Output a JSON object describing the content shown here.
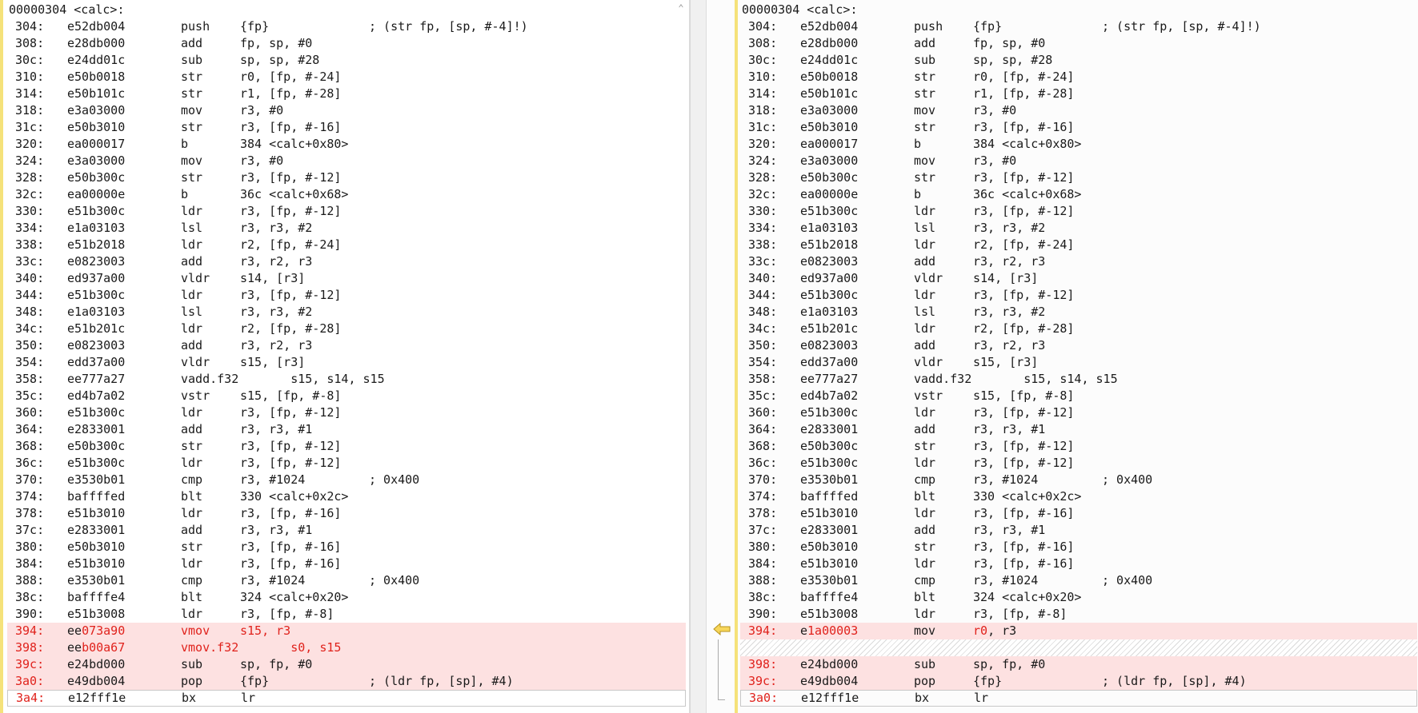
{
  "colors": {
    "removed_bg": "#fde1e1",
    "changed_text": "#e0221c",
    "gutter": "#f5e27a",
    "marker": "#e8c33a"
  },
  "icons": {
    "scroll_up": "chevron-up-icon",
    "diff_marker": "arrow-left-icon"
  },
  "left": {
    "header": "00000304 <calc>:",
    "rows": [
      {
        "a": "304:",
        "h": "e52db004",
        "m": "push",
        "o": "{fp}",
        "c": "; (str fp, [sp, #-4]!)"
      },
      {
        "a": "308:",
        "h": "e28db000",
        "m": "add",
        "o": "fp, sp, #0",
        "c": ""
      },
      {
        "a": "30c:",
        "h": "e24dd01c",
        "m": "sub",
        "o": "sp, sp, #28",
        "c": ""
      },
      {
        "a": "310:",
        "h": "e50b0018",
        "m": "str",
        "o": "r0, [fp, #-24]",
        "c": ""
      },
      {
        "a": "314:",
        "h": "e50b101c",
        "m": "str",
        "o": "r1, [fp, #-28]",
        "c": ""
      },
      {
        "a": "318:",
        "h": "e3a03000",
        "m": "mov",
        "o": "r3, #0",
        "c": ""
      },
      {
        "a": "31c:",
        "h": "e50b3010",
        "m": "str",
        "o": "r3, [fp, #-16]",
        "c": ""
      },
      {
        "a": "320:",
        "h": "ea000017",
        "m": "b",
        "o": "384 <calc+0x80>",
        "c": ""
      },
      {
        "a": "324:",
        "h": "e3a03000",
        "m": "mov",
        "o": "r3, #0",
        "c": ""
      },
      {
        "a": "328:",
        "h": "e50b300c",
        "m": "str",
        "o": "r3, [fp, #-12]",
        "c": ""
      },
      {
        "a": "32c:",
        "h": "ea00000e",
        "m": "b",
        "o": "36c <calc+0x68>",
        "c": ""
      },
      {
        "a": "330:",
        "h": "e51b300c",
        "m": "ldr",
        "o": "r3, [fp, #-12]",
        "c": ""
      },
      {
        "a": "334:",
        "h": "e1a03103",
        "m": "lsl",
        "o": "r3, r3, #2",
        "c": ""
      },
      {
        "a": "338:",
        "h": "e51b2018",
        "m": "ldr",
        "o": "r2, [fp, #-24]",
        "c": ""
      },
      {
        "a": "33c:",
        "h": "e0823003",
        "m": "add",
        "o": "r3, r2, r3",
        "c": ""
      },
      {
        "a": "340:",
        "h": "ed937a00",
        "m": "vldr",
        "o": "s14, [r3]",
        "c": ""
      },
      {
        "a": "344:",
        "h": "e51b300c",
        "m": "ldr",
        "o": "r3, [fp, #-12]",
        "c": ""
      },
      {
        "a": "348:",
        "h": "e1a03103",
        "m": "lsl",
        "o": "r3, r3, #2",
        "c": ""
      },
      {
        "a": "34c:",
        "h": "e51b201c",
        "m": "ldr",
        "o": "r2, [fp, #-28]",
        "c": ""
      },
      {
        "a": "350:",
        "h": "e0823003",
        "m": "add",
        "o": "r3, r2, r3",
        "c": ""
      },
      {
        "a": "354:",
        "h": "edd37a00",
        "m": "vldr",
        "o": "s15, [r3]",
        "c": ""
      },
      {
        "a": "358:",
        "h": "ee777a27",
        "m": "vadd.f32",
        "o": "       s15, s14, s15",
        "c": ""
      },
      {
        "a": "35c:",
        "h": "ed4b7a02",
        "m": "vstr",
        "o": "s15, [fp, #-8]",
        "c": ""
      },
      {
        "a": "360:",
        "h": "e51b300c",
        "m": "ldr",
        "o": "r3, [fp, #-12]",
        "c": ""
      },
      {
        "a": "364:",
        "h": "e2833001",
        "m": "add",
        "o": "r3, r3, #1",
        "c": ""
      },
      {
        "a": "368:",
        "h": "e50b300c",
        "m": "str",
        "o": "r3, [fp, #-12]",
        "c": ""
      },
      {
        "a": "36c:",
        "h": "e51b300c",
        "m": "ldr",
        "o": "r3, [fp, #-12]",
        "c": ""
      },
      {
        "a": "370:",
        "h": "e3530b01",
        "m": "cmp",
        "o": "r3, #1024",
        "c": "; 0x400"
      },
      {
        "a": "374:",
        "h": "baffffed",
        "m": "blt",
        "o": "330 <calc+0x2c>",
        "c": ""
      },
      {
        "a": "378:",
        "h": "e51b3010",
        "m": "ldr",
        "o": "r3, [fp, #-16]",
        "c": ""
      },
      {
        "a": "37c:",
        "h": "e2833001",
        "m": "add",
        "o": "r3, r3, #1",
        "c": ""
      },
      {
        "a": "380:",
        "h": "e50b3010",
        "m": "str",
        "o": "r3, [fp, #-16]",
        "c": ""
      },
      {
        "a": "384:",
        "h": "e51b3010",
        "m": "ldr",
        "o": "r3, [fp, #-16]",
        "c": ""
      },
      {
        "a": "388:",
        "h": "e3530b01",
        "m": "cmp",
        "o": "r3, #1024",
        "c": "; 0x400"
      },
      {
        "a": "38c:",
        "h": "baffffe4",
        "m": "blt",
        "o": "324 <calc+0x20>",
        "c": ""
      },
      {
        "a": "390:",
        "h": "e51b3008",
        "m": "ldr",
        "o": "r3, [fp, #-8]",
        "c": ""
      },
      {
        "a": "394:",
        "h": "ee073a90",
        "m": "vmov",
        "o": "s15, r3",
        "c": "",
        "t": "del-all"
      },
      {
        "a": "398:",
        "h": "eeb00a67",
        "m": "vmov.f32",
        "o": "       s0, s15",
        "c": "",
        "t": "del-all"
      },
      {
        "a": "39c:",
        "h": "e24bd000",
        "m": "sub",
        "o": "sp, fp, #0",
        "c": "",
        "t": "del-addr"
      },
      {
        "a": "3a0:",
        "h": "e49db004",
        "m": "pop",
        "o": "{fp}",
        "c": "; (ldr fp, [sp], #4)",
        "t": "del-addr"
      },
      {
        "a": "3a4:",
        "h": "e12fff1e",
        "m": "bx",
        "o": "lr",
        "c": "",
        "t": "last"
      }
    ]
  },
  "right": {
    "header": "00000304 <calc>:",
    "rows": [
      {
        "a": "304:",
        "h": "e52db004",
        "m": "push",
        "o": "{fp}",
        "c": "; (str fp, [sp, #-4]!)"
      },
      {
        "a": "308:",
        "h": "e28db000",
        "m": "add",
        "o": "fp, sp, #0",
        "c": ""
      },
      {
        "a": "30c:",
        "h": "e24dd01c",
        "m": "sub",
        "o": "sp, sp, #28",
        "c": ""
      },
      {
        "a": "310:",
        "h": "e50b0018",
        "m": "str",
        "o": "r0, [fp, #-24]",
        "c": ""
      },
      {
        "a": "314:",
        "h": "e50b101c",
        "m": "str",
        "o": "r1, [fp, #-28]",
        "c": ""
      },
      {
        "a": "318:",
        "h": "e3a03000",
        "m": "mov",
        "o": "r3, #0",
        "c": ""
      },
      {
        "a": "31c:",
        "h": "e50b3010",
        "m": "str",
        "o": "r3, [fp, #-16]",
        "c": ""
      },
      {
        "a": "320:",
        "h": "ea000017",
        "m": "b",
        "o": "384 <calc+0x80>",
        "c": ""
      },
      {
        "a": "324:",
        "h": "e3a03000",
        "m": "mov",
        "o": "r3, #0",
        "c": ""
      },
      {
        "a": "328:",
        "h": "e50b300c",
        "m": "str",
        "o": "r3, [fp, #-12]",
        "c": ""
      },
      {
        "a": "32c:",
        "h": "ea00000e",
        "m": "b",
        "o": "36c <calc+0x68>",
        "c": ""
      },
      {
        "a": "330:",
        "h": "e51b300c",
        "m": "ldr",
        "o": "r3, [fp, #-12]",
        "c": ""
      },
      {
        "a": "334:",
        "h": "e1a03103",
        "m": "lsl",
        "o": "r3, r3, #2",
        "c": ""
      },
      {
        "a": "338:",
        "h": "e51b2018",
        "m": "ldr",
        "o": "r2, [fp, #-24]",
        "c": ""
      },
      {
        "a": "33c:",
        "h": "e0823003",
        "m": "add",
        "o": "r3, r2, r3",
        "c": ""
      },
      {
        "a": "340:",
        "h": "ed937a00",
        "m": "vldr",
        "o": "s14, [r3]",
        "c": ""
      },
      {
        "a": "344:",
        "h": "e51b300c",
        "m": "ldr",
        "o": "r3, [fp, #-12]",
        "c": ""
      },
      {
        "a": "348:",
        "h": "e1a03103",
        "m": "lsl",
        "o": "r3, r3, #2",
        "c": ""
      },
      {
        "a": "34c:",
        "h": "e51b201c",
        "m": "ldr",
        "o": "r2, [fp, #-28]",
        "c": ""
      },
      {
        "a": "350:",
        "h": "e0823003",
        "m": "add",
        "o": "r3, r2, r3",
        "c": ""
      },
      {
        "a": "354:",
        "h": "edd37a00",
        "m": "vldr",
        "o": "s15, [r3]",
        "c": ""
      },
      {
        "a": "358:",
        "h": "ee777a27",
        "m": "vadd.f32",
        "o": "       s15, s14, s15",
        "c": ""
      },
      {
        "a": "35c:",
        "h": "ed4b7a02",
        "m": "vstr",
        "o": "s15, [fp, #-8]",
        "c": ""
      },
      {
        "a": "360:",
        "h": "e51b300c",
        "m": "ldr",
        "o": "r3, [fp, #-12]",
        "c": ""
      },
      {
        "a": "364:",
        "h": "e2833001",
        "m": "add",
        "o": "r3, r3, #1",
        "c": ""
      },
      {
        "a": "368:",
        "h": "e50b300c",
        "m": "str",
        "o": "r3, [fp, #-12]",
        "c": ""
      },
      {
        "a": "36c:",
        "h": "e51b300c",
        "m": "ldr",
        "o": "r3, [fp, #-12]",
        "c": ""
      },
      {
        "a": "370:",
        "h": "e3530b01",
        "m": "cmp",
        "o": "r3, #1024",
        "c": "; 0x400"
      },
      {
        "a": "374:",
        "h": "baffffed",
        "m": "blt",
        "o": "330 <calc+0x2c>",
        "c": ""
      },
      {
        "a": "378:",
        "h": "e51b3010",
        "m": "ldr",
        "o": "r3, [fp, #-16]",
        "c": ""
      },
      {
        "a": "37c:",
        "h": "e2833001",
        "m": "add",
        "o": "r3, r3, #1",
        "c": ""
      },
      {
        "a": "380:",
        "h": "e50b3010",
        "m": "str",
        "o": "r3, [fp, #-16]",
        "c": ""
      },
      {
        "a": "384:",
        "h": "e51b3010",
        "m": "ldr",
        "o": "r3, [fp, #-16]",
        "c": ""
      },
      {
        "a": "388:",
        "h": "e3530b01",
        "m": "cmp",
        "o": "r3, #1024",
        "c": "; 0x400"
      },
      {
        "a": "38c:",
        "h": "baffffe4",
        "m": "blt",
        "o": "324 <calc+0x20>",
        "c": ""
      },
      {
        "a": "390:",
        "h": "e51b3008",
        "m": "ldr",
        "o": "r3, [fp, #-8]",
        "c": ""
      },
      {
        "a": "394:",
        "h": "e1a00003",
        "m": "mov",
        "o": "r0, r3",
        "c": "",
        "t": "mod"
      },
      {
        "t": "filler"
      },
      {
        "a": "398:",
        "h": "e24bd000",
        "m": "sub",
        "o": "sp, fp, #0",
        "c": "",
        "t": "del-addr"
      },
      {
        "a": "39c:",
        "h": "e49db004",
        "m": "pop",
        "o": "{fp}",
        "c": "; (ldr fp, [sp], #4)",
        "t": "del-addr"
      },
      {
        "a": "3a0:",
        "h": "e12fff1e",
        "m": "bx",
        "o": "lr",
        "c": "",
        "t": "last"
      }
    ]
  }
}
